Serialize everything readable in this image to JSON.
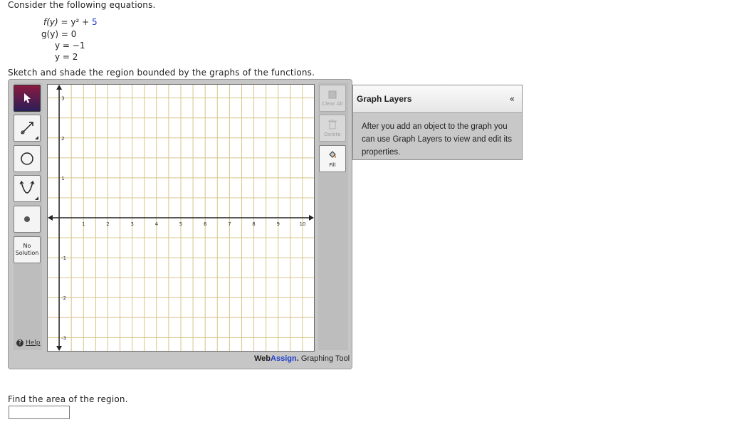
{
  "question": {
    "intro": "Consider the following equations.",
    "eq1": {
      "lhs": "f(y)",
      "mid": "= y² +",
      "rhs": "5"
    },
    "eq2": "g(y) = 0",
    "eq3": "y = −1",
    "eq4": "y = 2",
    "sketch_prompt": "Sketch and shade the region bounded by the graphs of the functions.",
    "area_prompt": "Find the area of the region."
  },
  "left_toolbar": {
    "no_solution_line1": "No",
    "no_solution_line2": "Solution",
    "help": "Help"
  },
  "right_toolbar": {
    "clear_all": "Clear All",
    "delete": "Delete",
    "fill": "Fill"
  },
  "graph": {
    "x_ticks": [
      "1",
      "2",
      "3",
      "4",
      "5",
      "6",
      "7",
      "8",
      "9",
      "10"
    ],
    "y_ticks_pos": [
      "3",
      "2",
      "1"
    ],
    "y_ticks_neg": [
      "-1",
      "-2",
      "-3"
    ],
    "xlim": [
      -0.5,
      10.5
    ],
    "ylim": [
      -3.35,
      3.35
    ],
    "grid_color": "#d8c48a",
    "axis_color": "#222222"
  },
  "layers_panel": {
    "title": "Graph Layers",
    "collapse": "«",
    "body": "After you add an object to the graph you can use Graph Layers to view and edit its properties."
  },
  "brand": {
    "web": "Web",
    "assign": "Assign",
    "dot": ".",
    "rest": " Graphing Tool"
  },
  "colors": {
    "active_tool": "#5a1a4a",
    "brand_blue": "#1f3fc9"
  }
}
